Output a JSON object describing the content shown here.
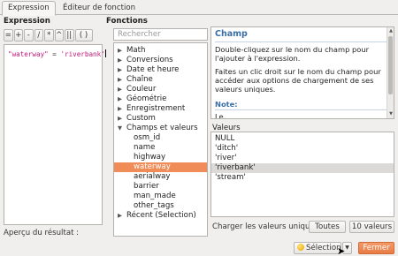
{
  "tabs": [
    "Expression",
    "Éditeur de fonction"
  ],
  "expression": {
    "title": "Expression",
    "operators": [
      "=",
      "+",
      "-",
      "/",
      "*",
      "^",
      "||",
      "(",
      ")"
    ],
    "code": {
      "field": "\"waterway\"",
      "operator": "=",
      "value": "'riverbank'"
    },
    "output_label": "Aperçu du résultat :"
  },
  "functions": {
    "title": "Fonctions",
    "search_placeholder": "Rechercher",
    "groups": [
      "Math",
      "Conversions",
      "Date et heure",
      "Chaîne",
      "Couleur",
      "Géométrie",
      "Enregistrement",
      "Custom"
    ],
    "expanded_group": "Champs et valeurs",
    "fields": [
      "osm_id",
      "name",
      "highway",
      "waterway",
      "aerialway",
      "barrier",
      "man_made",
      "other_tags"
    ],
    "selected_field": "waterway",
    "last_group": "Récent (Selection)"
  },
  "help": {
    "title": "Champ",
    "paragraph1": "Double-cliquez sur le nom du champ pour l'ajouter à l'expression.",
    "paragraph2": "Faites un clic droit sur le nom du champ pour accéder aux options de chargement de ses valeurs uniques.",
    "note_title": "Note:",
    "note_body": "Le..."
  },
  "values": {
    "title": "Valeurs",
    "items": [
      "NULL",
      "'ditch'",
      "'river'",
      "'riverbank'",
      "'stream'"
    ],
    "selected": "'riverbank'",
    "load_label": "Charger les valeurs uniques",
    "all_button": "Toutes",
    "ten_button": "10 valeurs"
  },
  "actions": {
    "selection_button": "Sélection",
    "close_button": "Fermer"
  },
  "colors": {
    "accent": "#f08c58",
    "help_title": "#3a6ea5",
    "string_literal": "#c2197a"
  }
}
